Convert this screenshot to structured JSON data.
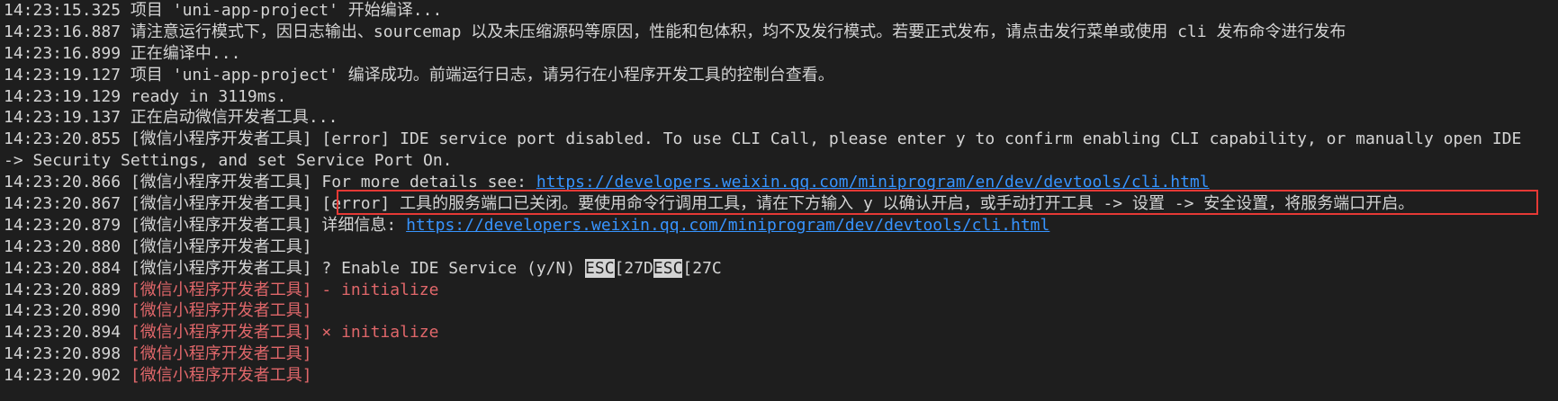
{
  "lines": [
    {
      "ts": "14:23:15.325",
      "text": "项目 'uni-app-project' 开始编译..."
    },
    {
      "ts": "14:23:16.887",
      "text": "请注意运行模式下，因日志输出、sourcemap 以及未压缩源码等原因，性能和包体积，均不及发行模式。若要正式发布，请点击发行菜单或使用 cli 发布命令进行发布"
    },
    {
      "ts": "14:23:16.899",
      "text": "正在编译中..."
    },
    {
      "ts": "14:23:19.127",
      "text": "项目 'uni-app-project' 编译成功。前端运行日志，请另行在小程序开发工具的控制台查看。"
    },
    {
      "ts": "14:23:19.129",
      "text": "ready in 3119ms."
    },
    {
      "ts": "14:23:19.137",
      "text": "正在启动微信开发者工具..."
    },
    {
      "ts": "14:23:20.855",
      "tag": "[微信小程序开发者工具]",
      "text": " [error] IDE service port disabled. To use CLI Call, please enter y to confirm enabling CLI capability, or manually open IDE"
    },
    {
      "continuation": "-> Security Settings, and set Service Port On."
    },
    {
      "ts": "14:23:20.866",
      "tag": "[微信小程序开发者工具]",
      "text": " For more details see: ",
      "link": "https://developers.weixin.qq.com/miniprogram/en/dev/devtools/cli.html"
    },
    {
      "ts": "14:23:20.867",
      "tag": "[微信小程序开发者工具]",
      "text": " [error] 工具的服务端口已关闭。要使用命令行调用工具，请在下方输入 y 以确认开启，或手动打开工具 -> 设置 -> 安全设置，将服务端口开启。"
    },
    {
      "ts": "14:23:20.879",
      "tag": "[微信小程序开发者工具]",
      "text": " 详细信息: ",
      "link": "https://developers.weixin.qq.com/miniprogram/dev/devtools/cli.html"
    },
    {
      "ts": "14:23:20.880",
      "tag": "[微信小程序开发者工具]",
      "text": ""
    },
    {
      "ts": "14:23:20.884",
      "tag": "[微信小程序开发者工具]",
      "text": " ? Enable IDE Service (y/N) ",
      "esc1": "ESC",
      "mid": "[27D",
      "esc2": "ESC",
      "tail": "[27C"
    },
    {
      "ts": "14:23:20.889",
      "tag": "[微信小程序开发者工具]",
      "text": " - initialize",
      "red": true
    },
    {
      "ts": "14:23:20.890",
      "tag": "[微信小程序开发者工具]",
      "text": "",
      "red": true
    },
    {
      "ts": "14:23:20.894",
      "tag": "[微信小程序开发者工具]",
      "text": " × initialize",
      "red": true
    },
    {
      "ts": "14:23:20.898",
      "tag": "[微信小程序开发者工具]",
      "text": "",
      "red": true
    },
    {
      "ts": "14:23:20.902",
      "tag": "[微信小程序开发者工具]",
      "text": "",
      "red": true
    }
  ],
  "colors": {
    "background": "#1e1e1e",
    "text": "#d4d4d4",
    "error_red": "#e0676a",
    "link_blue": "#3794ff",
    "highlight_box": "#e53935"
  }
}
